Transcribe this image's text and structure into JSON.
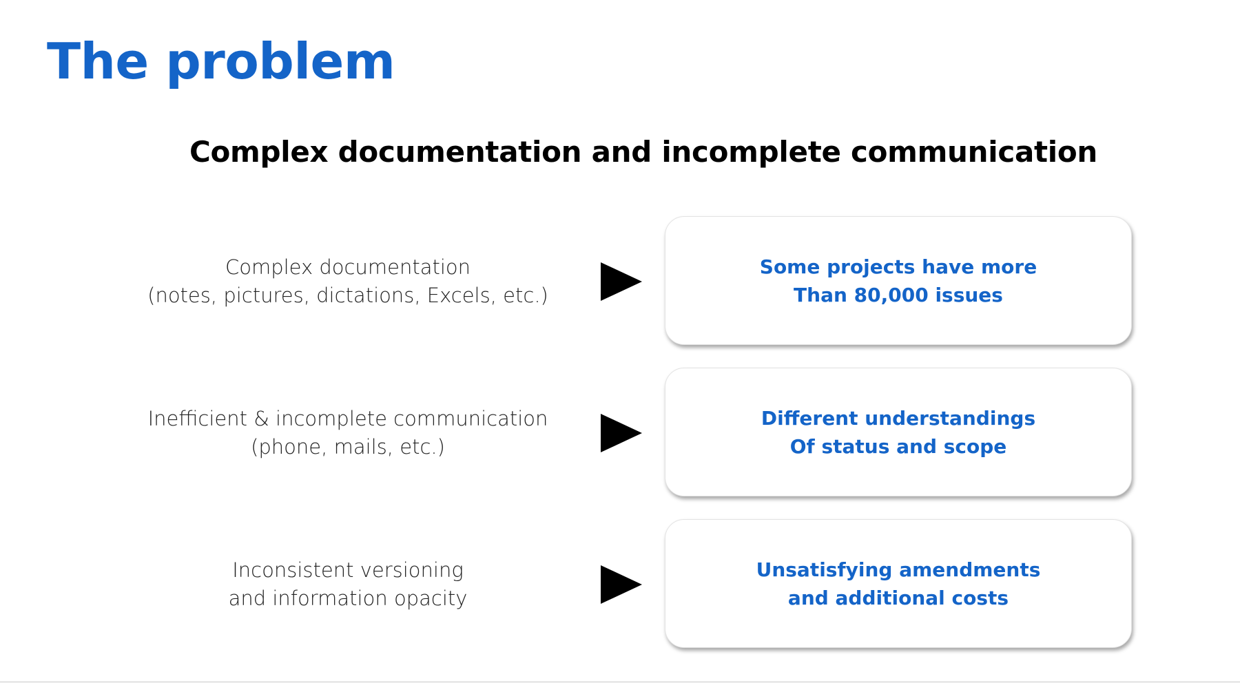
{
  "title": "The problem",
  "subtitle": "Complex documentation and incomplete communication",
  "rows": [
    {
      "cause": [
        "Complex documentation",
        "(notes, pictures, dictations, Excels, etc.)"
      ],
      "effect": [
        "Some projects have more",
        "Than 80,000 issues"
      ]
    },
    {
      "cause": [
        "Inefficient & incomplete communication",
        "(phone, mails, etc.)"
      ],
      "effect": [
        "Different understandings",
        "Of status and scope"
      ]
    },
    {
      "cause": [
        "Inconsistent versioning",
        "and information opacity"
      ],
      "effect": [
        "Unsatisfying amendments",
        "and additional costs"
      ]
    }
  ],
  "colors": {
    "accent": "#1464c8",
    "text": "#000000",
    "arrow": "#000000"
  },
  "icons": {
    "arrow": "play-triangle-icon"
  }
}
